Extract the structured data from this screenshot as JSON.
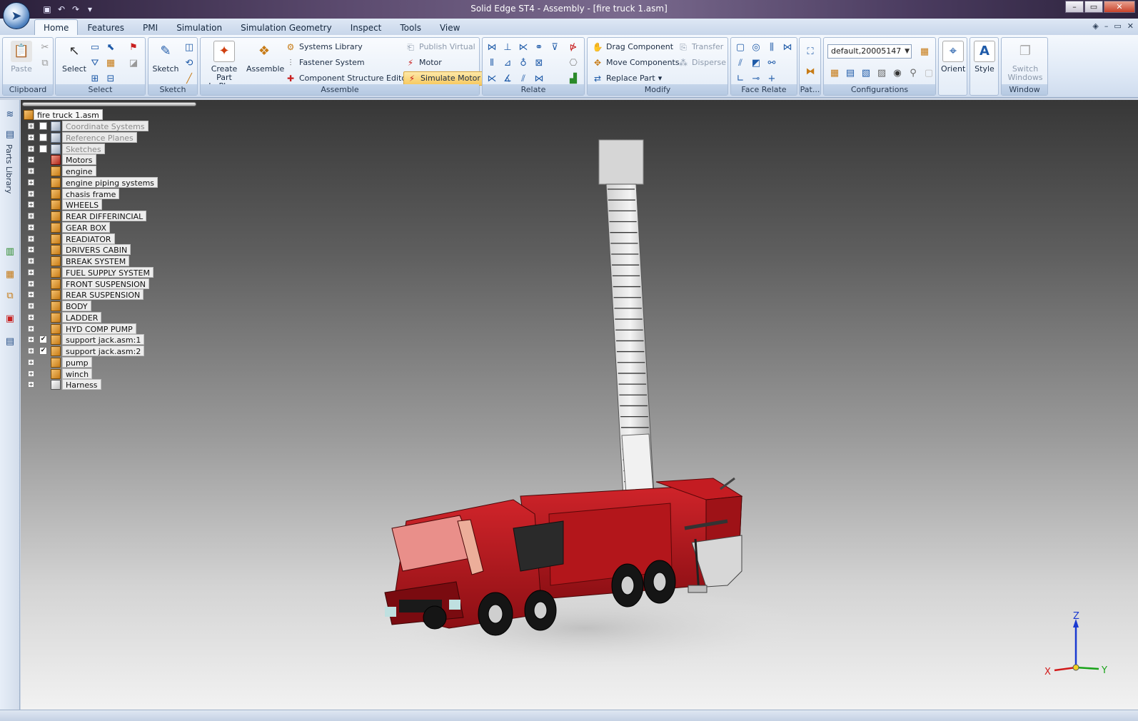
{
  "window": {
    "title": "Solid Edge ST4 - Assembly - [fire truck 1.asm]",
    "controls": [
      "–",
      "▭",
      "✕"
    ],
    "doc_controls": [
      "–",
      "▭",
      "✕"
    ]
  },
  "tabs": [
    "Home",
    "Features",
    "PMI",
    "Simulation",
    "Simulation Geometry",
    "Inspect",
    "Tools",
    "View"
  ],
  "ribbon": {
    "clipboard": {
      "label": "Clipboard",
      "paste": "Paste"
    },
    "select": {
      "label": "Select",
      "select": "Select"
    },
    "sketch": {
      "label": "Sketch",
      "sketch": "Sketch"
    },
    "assemble": {
      "label": "Assemble",
      "create_part_line1": "Create Part",
      "create_part_line2": "In-Place",
      "assemble": "Assemble",
      "systems_library": "Systems Library",
      "fastener_system": "Fastener System",
      "component_structure_editor": "Component Structure Editor",
      "publish_virtual": "Publish Virtual",
      "motor": "Motor",
      "simulate_motor": "Simulate Motor"
    },
    "relate": {
      "label": "Relate"
    },
    "modify": {
      "label": "Modify",
      "drag_component": "Drag Component",
      "move_components": "Move Components",
      "replace_part": "Replace Part",
      "transfer": "Transfer",
      "disperse": "Disperse"
    },
    "face_relate": {
      "label": "Face Relate"
    },
    "pattern": {
      "label": "Pat..."
    },
    "configurations": {
      "label": "Configurations",
      "current": "default,20005147"
    },
    "orient": {
      "label": "Orient"
    },
    "style": {
      "label": "Style"
    },
    "window_group": {
      "label": "Window",
      "switch_line1": "Switch",
      "switch_line2": "Windows"
    }
  },
  "sidebar": {
    "parts_library": "Parts Library"
  },
  "tree": {
    "root": "fire truck 1.asm",
    "items": [
      {
        "label": "Coordinate Systems",
        "dim": true,
        "checkbox": "empty",
        "icon": "grey"
      },
      {
        "label": "Reference Planes",
        "dim": true,
        "checkbox": "empty",
        "icon": "grey"
      },
      {
        "label": "Sketches",
        "dim": true,
        "checkbox": "empty",
        "icon": "grey"
      },
      {
        "label": "Motors",
        "dim": false,
        "checkbox": "none",
        "icon": "motor"
      },
      {
        "label": "engine",
        "dim": false,
        "checkbox": "none",
        "icon": "part"
      },
      {
        "label": "engine piping systems",
        "dim": false,
        "checkbox": "none",
        "icon": "part"
      },
      {
        "label": "chasis frame",
        "dim": false,
        "checkbox": "none",
        "icon": "part"
      },
      {
        "label": "WHEELS",
        "dim": false,
        "checkbox": "none",
        "icon": "part"
      },
      {
        "label": "REAR DIFFERINCIAL",
        "dim": false,
        "checkbox": "none",
        "icon": "part"
      },
      {
        "label": "GEAR BOX",
        "dim": false,
        "checkbox": "none",
        "icon": "part"
      },
      {
        "label": "READIATOR",
        "dim": false,
        "checkbox": "none",
        "icon": "part"
      },
      {
        "label": "DRIVERS CABIN",
        "dim": false,
        "checkbox": "none",
        "icon": "part"
      },
      {
        "label": "BREAK SYSTEM",
        "dim": false,
        "checkbox": "none",
        "icon": "part"
      },
      {
        "label": "FUEL SUPPLY SYSTEM",
        "dim": false,
        "checkbox": "none",
        "icon": "part"
      },
      {
        "label": "FRONT SUSPENSION",
        "dim": false,
        "checkbox": "none",
        "icon": "part"
      },
      {
        "label": "REAR SUSPENSION",
        "dim": false,
        "checkbox": "none",
        "icon": "part"
      },
      {
        "label": "BODY",
        "dim": false,
        "checkbox": "none",
        "icon": "part"
      },
      {
        "label": "LADDER",
        "dim": false,
        "checkbox": "none",
        "icon": "part"
      },
      {
        "label": "HYD COMP PUMP",
        "dim": false,
        "checkbox": "none",
        "icon": "part"
      },
      {
        "label": "support jack.asm:1",
        "dim": false,
        "checkbox": "checked",
        "icon": "part"
      },
      {
        "label": "support jack.asm:2",
        "dim": false,
        "checkbox": "checked",
        "icon": "part"
      },
      {
        "label": "pump",
        "dim": false,
        "checkbox": "none",
        "icon": "part"
      },
      {
        "label": "winch",
        "dim": false,
        "checkbox": "none",
        "icon": "part"
      },
      {
        "label": "Harness",
        "dim": false,
        "checkbox": "none",
        "icon": "harness"
      }
    ]
  },
  "triad": {
    "x": "X",
    "y": "Y",
    "z": "Z",
    "colors": {
      "x": "#d11a1a",
      "y": "#1aa31a",
      "z": "#1a3ad1"
    }
  },
  "colors": {
    "truck_red": "#b3161b",
    "ribbon_blue": "#dfe9f6"
  }
}
